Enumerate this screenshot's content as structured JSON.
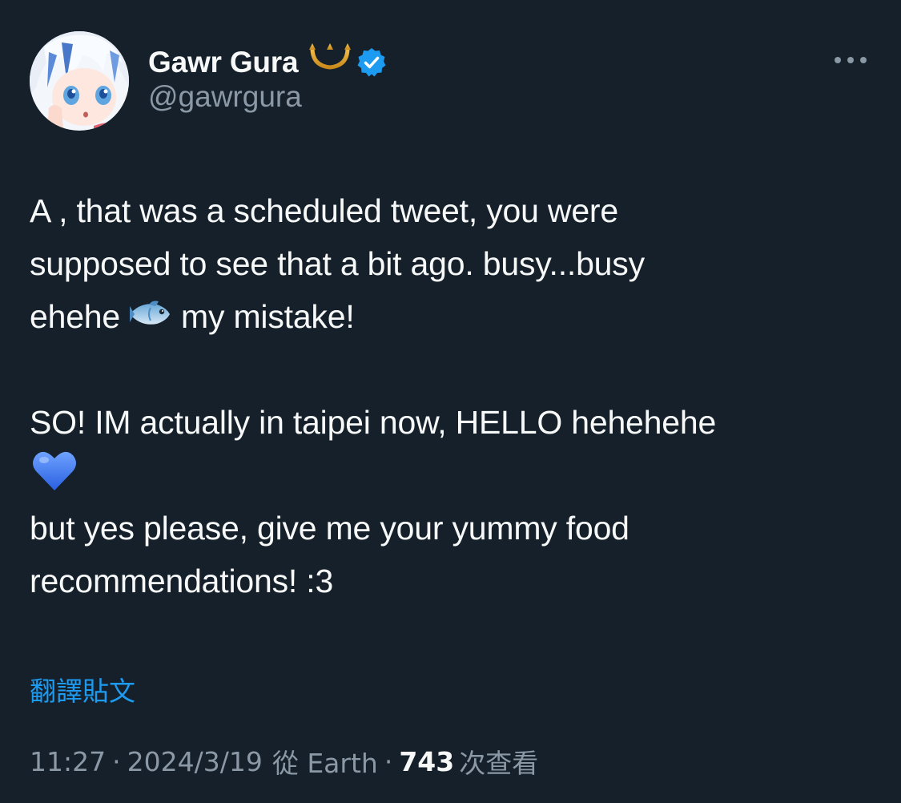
{
  "author": {
    "display_name": "Gawr Gura",
    "handle": "@gawrgura",
    "badge_emoji": "trident-icon",
    "verified": true,
    "verified_color": "#1d9bf0"
  },
  "tweet": {
    "lines": [
      {
        "text": "A , that was a scheduled tweet, you were"
      },
      {
        "text": "supposed to see that a bit ago. busy...busy"
      },
      {
        "before": "ehehe",
        "emoji": "fish-icon",
        "after": "my mistake!"
      },
      {
        "text": ""
      },
      {
        "text": "SO! IM actually in taipei now, HELLO hehehehe"
      },
      {
        "emoji": "blue-heart-icon"
      },
      {
        "text": "but yes please, give me your yummy food"
      },
      {
        "text": "recommendations! :3"
      }
    ],
    "line_1": "A , that was a scheduled tweet, you were",
    "line_2": "supposed to see that a bit ago. busy...busy",
    "line_3_before": "ehehe",
    "line_3_after": "my mistake!",
    "line_5": "SO! IM actually in taipei now, HELLO hehehehe",
    "line_7": "but yes please, give me your yummy food",
    "line_8": "recommendations! :3"
  },
  "translate_label": "翻譯貼文",
  "meta": {
    "time": "11:27",
    "date": "2024/3/19",
    "source": "從 Earth",
    "views_count": "743",
    "views_label": "次查看",
    "separator": "·"
  },
  "colors": {
    "background": "#15202b",
    "text": "#f7f9f9",
    "muted": "#8b98a5",
    "link": "#1d9bf0"
  }
}
